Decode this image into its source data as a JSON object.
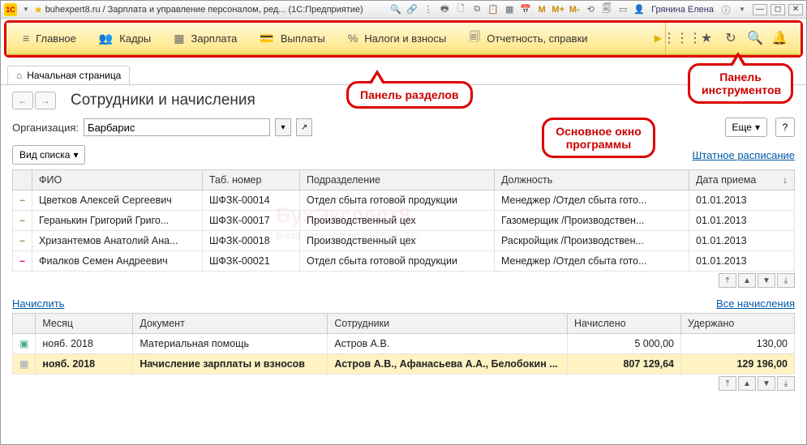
{
  "window": {
    "title": "buhexpert8.ru / Зарплата и управление персоналом, ред... (1С:Предприятие)",
    "user": "Грянина Елена"
  },
  "sections": {
    "items": [
      {
        "icon": "≡",
        "label": "Главное"
      },
      {
        "icon": "👥",
        "label": "Кадры"
      },
      {
        "icon": "▦",
        "label": "Зарплата"
      },
      {
        "icon": "💳",
        "label": "Выплаты"
      },
      {
        "icon": "%",
        "label": "Налоги и взносы"
      },
      {
        "icon": "🗐",
        "label": "Отчетность, справки"
      }
    ]
  },
  "tab": {
    "label": "Начальная страница"
  },
  "page": {
    "title": "Сотрудники и начисления",
    "org_label": "Организация:",
    "org_value": "Барбарис",
    "more": "Еще",
    "help": "?",
    "view_mode": "Вид списка",
    "staffing_link": "Штатное расписание",
    "accrue_link": "Начислить",
    "all_accruals_link": "Все начисления"
  },
  "emp_table": {
    "headers": {
      "fio": "ФИО",
      "tabnum": "Таб. номер",
      "dept": "Подразделение",
      "pos": "Должность",
      "hired": "Дата приема"
    },
    "rows": [
      {
        "fio": "Цветков Алексей Сергеевич",
        "tabnum": "ШФЗК-00014",
        "dept": "Отдел сбыта готовой продукции",
        "pos": "Менеджер /Отдел сбыта гото...",
        "hired": "01.01.2013"
      },
      {
        "fio": "Геранькин Григорий Григо...",
        "tabnum": "ШФЗК-00017",
        "dept": "Производственный цех",
        "pos": "Газомерщик /Производствен...",
        "hired": "01.01.2013"
      },
      {
        "fio": "Хризантемов Анатолий Ана...",
        "tabnum": "ШФЗК-00018",
        "dept": "Производственный цех",
        "pos": "Раскройщик /Производствен...",
        "hired": "01.01.2013"
      },
      {
        "fio": "Фиалков Семен Андреевич",
        "tabnum": "ШФЗК-00021",
        "dept": "Отдел сбыта готовой продукции",
        "pos": "Менеджер /Отдел сбыта гото...",
        "hired": "01.01.2013"
      }
    ]
  },
  "acc_table": {
    "headers": {
      "month": "Месяц",
      "doc": "Документ",
      "emp": "Сотрудники",
      "accrued": "Начислено",
      "withheld": "Удержано"
    },
    "rows": [
      {
        "month": "нояб. 2018",
        "doc": "Материальная помощь",
        "emp": "Астров А.В.",
        "accrued": "5 000,00",
        "withheld": "130,00",
        "sel": false
      },
      {
        "month": "нояб. 2018",
        "doc": "Начисление зарплаты и взносов",
        "emp": "Астров А.В., Афанасьева А.А., Белобокин ...",
        "accrued": "807 129,64",
        "withheld": "129 196,00",
        "sel": true
      }
    ]
  },
  "callouts": {
    "c1": "Панель разделов",
    "c2": "Основное окно программы",
    "c3": "Панель инструментов"
  },
  "watermark": {
    "line1": "БухЭксперт8",
    "line2": "База ответов по учёту в 1С"
  }
}
